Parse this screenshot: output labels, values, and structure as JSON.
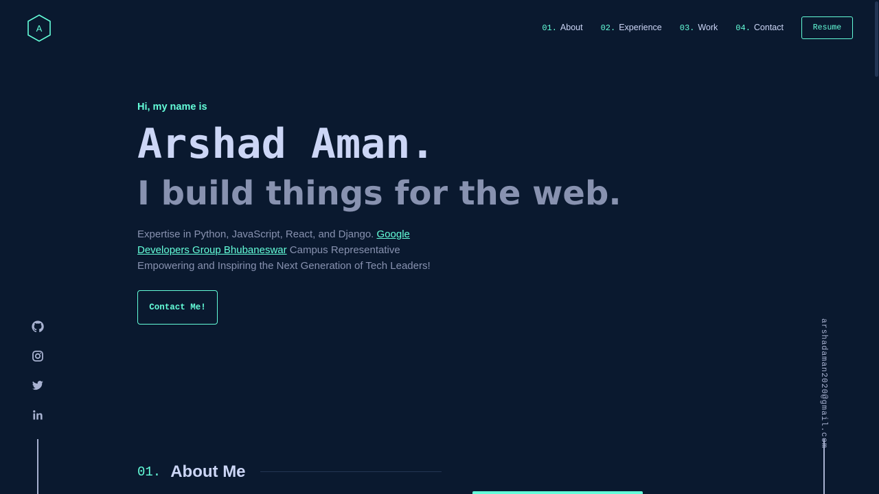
{
  "logo": {
    "letter": "A"
  },
  "nav": {
    "items": [
      {
        "num": "01.",
        "label": "About"
      },
      {
        "num": "02.",
        "label": "Experience"
      },
      {
        "num": "03.",
        "label": "Work"
      },
      {
        "num": "04.",
        "label": "Contact"
      }
    ],
    "resume_label": "Resume"
  },
  "hero": {
    "greeting": "Hi, my name is",
    "name": "Arshad Aman.",
    "tagline": "I build things for the web.",
    "bio_prefix": "Expertise in Python, JavaScript, React, and Django. ",
    "bio_link": "Google Developers Group Bhubaneswar",
    "bio_suffix": " Campus Representative Empowering and Inspiring the Next Generation of Tech Leaders!",
    "cta_label": "Contact Me!"
  },
  "social": {
    "icons": [
      "github-icon",
      "instagram-icon",
      "twitter-icon",
      "linkedin-icon"
    ]
  },
  "email": "arshadaman2020@gmail.com",
  "about": {
    "num": "01.",
    "title": "About Me"
  },
  "colors": {
    "background": "#0a192f",
    "accent": "#64ffda",
    "lightest_slate": "#ccd6f6",
    "slate": "#8892b0",
    "light_slate": "#a8b2d1"
  }
}
